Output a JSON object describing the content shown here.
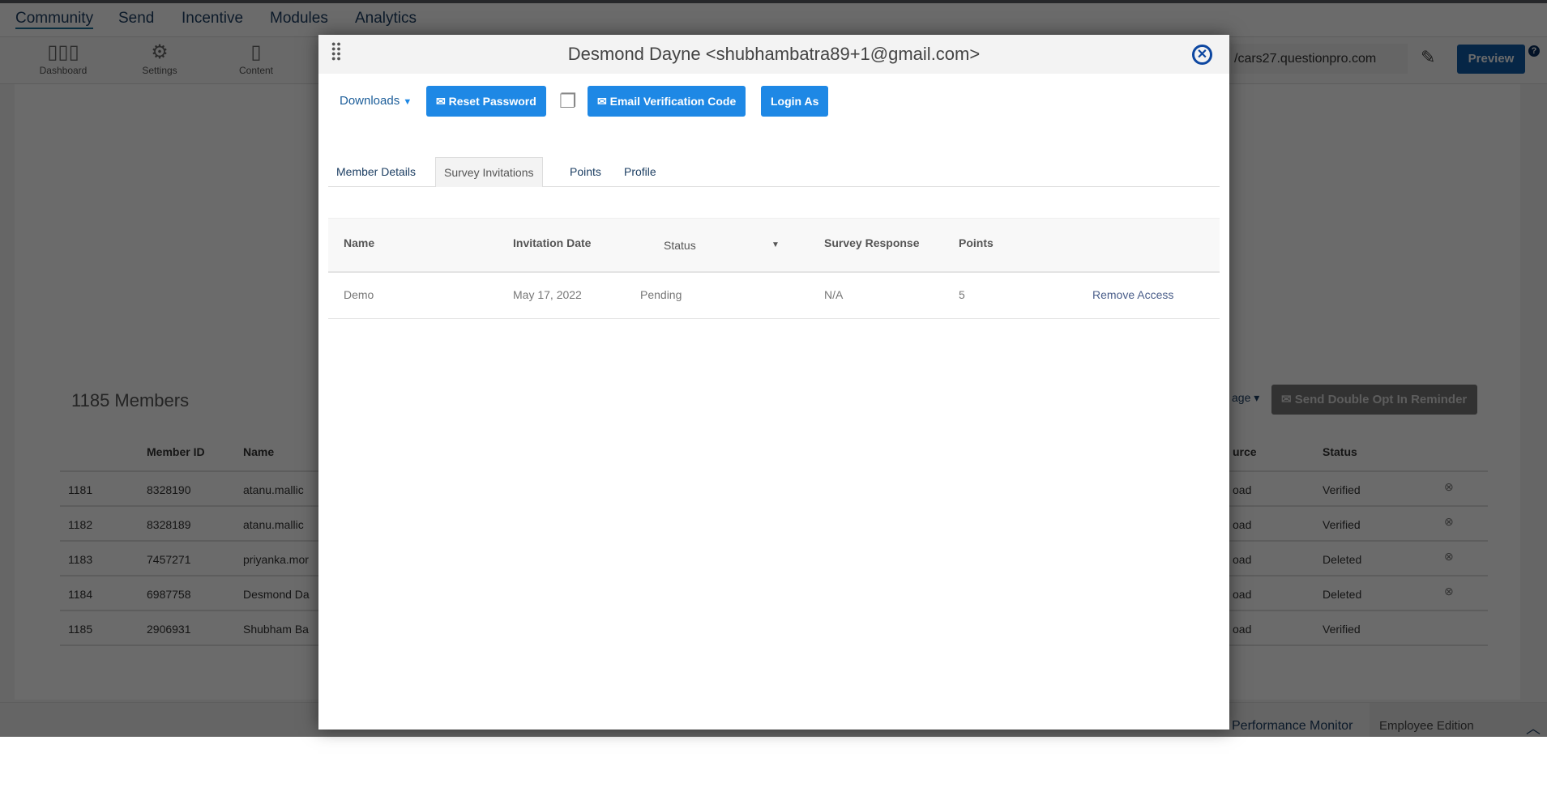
{
  "nav": {
    "items": [
      "Community",
      "Send",
      "Incentive",
      "Modules",
      "Analytics"
    ]
  },
  "toolbar": {
    "items": [
      "Dashboard",
      "Settings",
      "Content"
    ],
    "url": "/cars27.questionpro.com",
    "preview": "Preview",
    "help": "?"
  },
  "members": {
    "title": "1185 Members",
    "page_dropdown": "age",
    "reminder_button": "Send Double Opt In Reminder",
    "headers": [
      "",
      "Member ID",
      "Name",
      "urce",
      "Status"
    ],
    "rows": [
      {
        "n": "1181",
        "id": "8328190",
        "name": "atanu.mallic",
        "source": "oad",
        "status": "Verified"
      },
      {
        "n": "1182",
        "id": "8328189",
        "name": "atanu.mallic",
        "source": "oad",
        "status": "Verified"
      },
      {
        "n": "1183",
        "id": "7457271",
        "name": "priyanka.mor",
        "source": "oad",
        "status": "Deleted"
      },
      {
        "n": "1184",
        "id": "6987758",
        "name": "Desmond Da",
        "source": "oad",
        "status": "Deleted"
      },
      {
        "n": "1185",
        "id": "2906931",
        "name": "Shubham Ba",
        "source": "oad",
        "status": "Verified"
      }
    ]
  },
  "footer": {
    "left": "Performance Monitor",
    "right": "Employee Edition"
  },
  "modal": {
    "title": "Desmond Dayne <shubhambatra89+1@gmail.com>",
    "downloads": "Downloads",
    "reset_password": "Reset Password",
    "email_code": "Email Verification Code",
    "login_as": "Login As",
    "tabs": [
      "Member Details",
      "Survey Invitations",
      "Points",
      "Profile"
    ],
    "table": {
      "headers": [
        "Name",
        "Invitation Date",
        "Status",
        "Survey Response",
        "Points"
      ],
      "rows": [
        {
          "name": "Demo",
          "date": "May 17, 2022",
          "status": "Pending",
          "response": "N/A",
          "points": "5",
          "action": "Remove Access"
        }
      ]
    }
  },
  "colors": {
    "primary": "#1e88e5",
    "nav": "#1d3f63",
    "close": "#0d47a1"
  }
}
